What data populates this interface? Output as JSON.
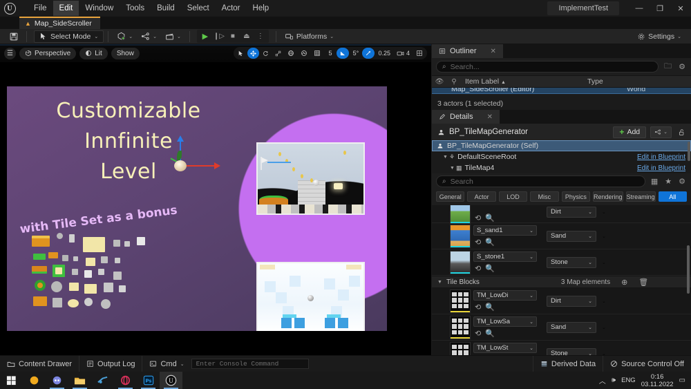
{
  "titlebar": {
    "project_name": "ImplementTest",
    "minimize": "—",
    "maximize": "❐",
    "close": "✕",
    "menus": [
      {
        "label": "File"
      },
      {
        "label": "Edit"
      },
      {
        "label": "Window"
      },
      {
        "label": "Tools"
      },
      {
        "label": "Build"
      },
      {
        "label": "Select"
      },
      {
        "label": "Actor"
      },
      {
        "label": "Help"
      }
    ]
  },
  "tabbar": {
    "map_tab": "Map_SideScroller"
  },
  "toolbar": {
    "save_label": "",
    "select_mode": "Select Mode",
    "platforms": "Platforms",
    "settings": "Settings",
    "chevron": "⌄"
  },
  "viewport": {
    "view_mode": "Perspective",
    "lighting": "Lit",
    "show": "Show",
    "grid_snap_value": "5",
    "angle_snap_value": "5°",
    "scale_snap_value": "0.25",
    "camera_speed_value": "4",
    "axis": {
      "x": "X",
      "y": "Y",
      "z": "Z"
    },
    "promo": {
      "line1": "Customizable",
      "line2": "Innfinite",
      "line3": "Level",
      "subtitle": "with Tile Set as a bonus",
      "title_color": "#f7f0b8",
      "subtitle_color": "#e6b9f7"
    }
  },
  "outliner": {
    "tab_label": "Outliner",
    "close": "✕",
    "search_placeholder": "Search...",
    "columns": {
      "label": "Item Label",
      "type": "Type",
      "sort_arrow": "▲"
    },
    "cut_row_label": "Map_SideScroller (Editor)",
    "cut_row_type": "World",
    "status": "3 actors (1 selected)"
  },
  "details": {
    "tab_label": "Details",
    "close": "✕",
    "object_name": "BP_TileMapGenerator",
    "add_label": "Add",
    "components": [
      {
        "label": "BP_TileMapGenerator (Self)",
        "link": "",
        "selected": true,
        "indent": 0
      },
      {
        "label": "DefaultSceneRoot",
        "link": "Edit in Blueprint",
        "selected": false,
        "indent": 1
      },
      {
        "label": "TileMap4",
        "link": "Edit in Blueprint",
        "selected": false,
        "indent": 2
      }
    ],
    "search_placeholder": "Search",
    "filters": [
      {
        "label": "General",
        "active": false
      },
      {
        "label": "Actor",
        "active": false
      },
      {
        "label": "LOD",
        "active": false
      },
      {
        "label": "Misc",
        "active": false
      },
      {
        "label": "Physics",
        "active": false
      },
      {
        "label": "Rendering",
        "active": false
      },
      {
        "label": "Streaming",
        "active": false
      },
      {
        "label": "All",
        "active": true
      }
    ],
    "sprite_rows": [
      {
        "asset": "",
        "enum": "Dirt",
        "thumb": "grass"
      },
      {
        "asset": "S_sand1",
        "enum": "Sand",
        "thumb": "sand"
      },
      {
        "asset": "S_stone1",
        "enum": "Stone",
        "thumb": "stone"
      }
    ],
    "tile_blocks": {
      "label": "Tile Blocks",
      "elements_count": "3 Map elements",
      "rows": [
        {
          "asset": "TM_LowDi",
          "enum": "Dirt"
        },
        {
          "asset": "TM_LowSa",
          "enum": "Sand"
        },
        {
          "asset": "TM_LowSt",
          "enum": "Stone"
        }
      ]
    }
  },
  "statusbar": {
    "content_drawer": "Content Drawer",
    "output_log": "Output Log",
    "cmd": "Cmd",
    "console_placeholder": "Enter Console Command",
    "derived_data": "Derived Data",
    "source_control": "Source Control Off"
  },
  "taskbar": {
    "language": "ENG",
    "time": "0:16",
    "date": "03.11.2022",
    "chevron_up": "︿",
    "speaker": "🕪"
  }
}
